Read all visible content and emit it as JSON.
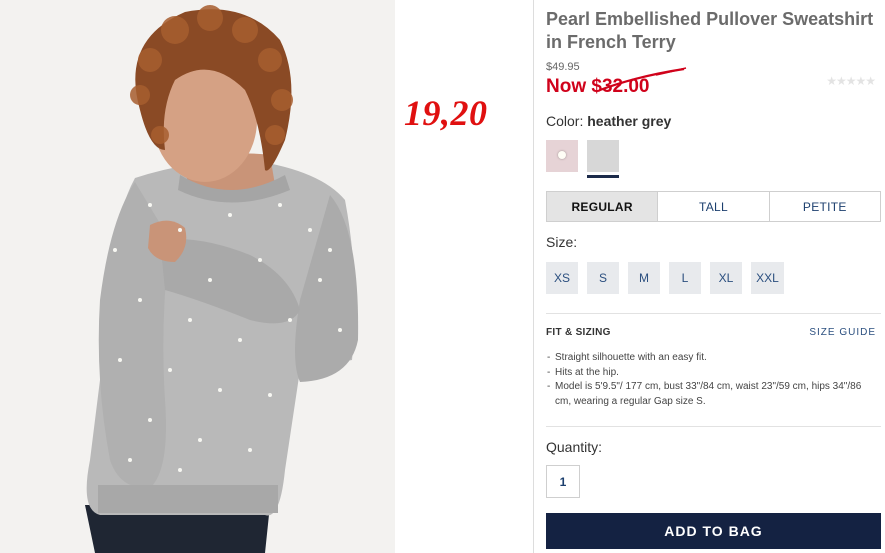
{
  "annotation": {
    "handwritten_price": "19,20"
  },
  "product": {
    "title": "Pearl Embellished Pullover Sweatshirt in French Terry",
    "original_price": "$49.95",
    "now_label": "Now",
    "now_price": "$32.00",
    "rating_stars": "★★★★★",
    "rating_value": 0
  },
  "color": {
    "label": "Color:",
    "selected": "heather grey",
    "swatches": [
      {
        "name": "pink",
        "hex": "#e6d3d6"
      },
      {
        "name": "heather grey",
        "hex": "#d7d7d7"
      }
    ]
  },
  "fit_tabs": [
    "REGULAR",
    "TALL",
    "PETITE"
  ],
  "size": {
    "label": "Size:",
    "options": [
      "XS",
      "S",
      "M",
      "L",
      "XL",
      "XXL"
    ]
  },
  "fit_sizing": {
    "heading": "FIT & SIZING",
    "size_guide_label": "SIZE GUIDE",
    "bullets": [
      "Straight silhouette with an easy fit.",
      "Hits at the hip.",
      "Model is 5'9.5\"/ 177 cm, bust 33\"/84 cm, waist 23\"/59 cm, hips 34\"/86 cm, wearing a regular Gap size S."
    ]
  },
  "quantity": {
    "label": "Quantity:",
    "value": "1"
  },
  "cta": {
    "add_to_bag": "ADD TO BAG"
  },
  "colors": {
    "sale_red": "#d0021b",
    "navy": "#142242",
    "link_blue": "#2b4f7f",
    "annotation_red": "#e01010"
  }
}
